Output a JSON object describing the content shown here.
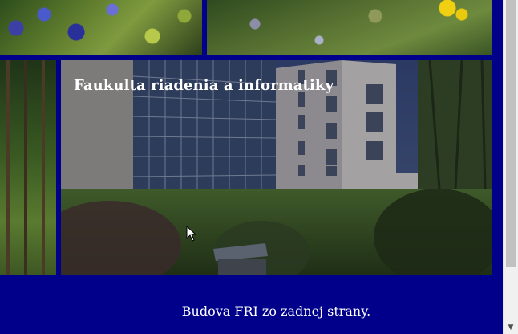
{
  "gallery": {
    "hero_title": "Faukulta riadenia a informatiky",
    "caption": "Budova FRI zo zadnej strany."
  },
  "scrollbar": {
    "down_arrow": "▼"
  },
  "colors": {
    "page_background": "#00008b",
    "title_text": "#ffffff",
    "scrollbar_track": "#f0f0f0",
    "scrollbar_thumb": "#c1c1c1"
  },
  "icons": [
    "mouse-cursor-icon",
    "scroll-down-arrow-icon"
  ]
}
